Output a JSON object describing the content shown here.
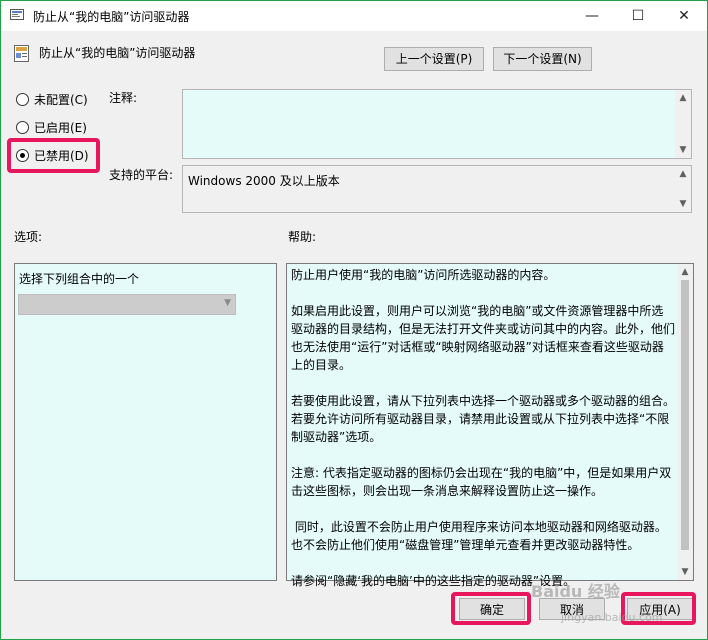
{
  "window": {
    "title": "防止从“我的电脑”访问驱动器",
    "minimize_glyph": "—",
    "maximize_glyph": "☐",
    "close_glyph": "✕",
    "accent": "#1fa14a"
  },
  "header": {
    "policy_name": "防止从“我的电脑”访问驱动器",
    "prev_label": "上一个设置(P)",
    "next_label": "下一个设置(N)"
  },
  "state": {
    "options": [
      {
        "label": "未配置(C)",
        "checked": false
      },
      {
        "label": "已启用(E)",
        "checked": false
      },
      {
        "label": "已禁用(D)",
        "checked": true
      }
    ]
  },
  "fields": {
    "comment_label": "注释:",
    "comment_value": "",
    "platform_label": "支持的平台:",
    "platform_value": "Windows 2000 及以上版本",
    "options_label": "选项:",
    "help_label": "帮助:"
  },
  "options_panel": {
    "prompt": "选择下列组合中的一个",
    "selected": ""
  },
  "help": {
    "text": "防止用户使用“我的电脑”访问所选驱动器的内容。\n\n如果启用此设置，则用户可以浏览“我的电脑”或文件资源管理器中所选驱动器的目录结构，但是无法打开文件夹或访问其中的内容。此外，他们也无法使用“运行”对话框或“映射网络驱动器”对话框来查看这些驱动器上的目录。\n\n若要使用此设置，请从下拉列表中选择一个驱动器或多个驱动器的组合。若要允许访问所有驱动器目录，请禁用此设置或从下拉列表中选择“不限制驱动器”选项。\n\n注意: 代表指定驱动器的图标仍会出现在“我的电脑”中，但是如果用户双击这些图标，则会出现一条消息来解释设置防止这一操作。\n\n 同时，此设置不会防止用户使用程序来访问本地驱动器和网络驱动器。也不会防止他们使用“磁盘管理”管理单元查看并更改驱动器特性。\n\n请参阅“隐藏‘我的电脑’中的这些指定的驱动器”设置。"
  },
  "footer": {
    "ok_label": "确定",
    "cancel_label": "取消",
    "apply_label": "应用(A)"
  },
  "watermark": {
    "brand": "Baidu 经验",
    "url": "jingyan.baidu.com"
  },
  "colors": {
    "highlight": "#e8175d",
    "field_bg": "#e4fbfa"
  }
}
